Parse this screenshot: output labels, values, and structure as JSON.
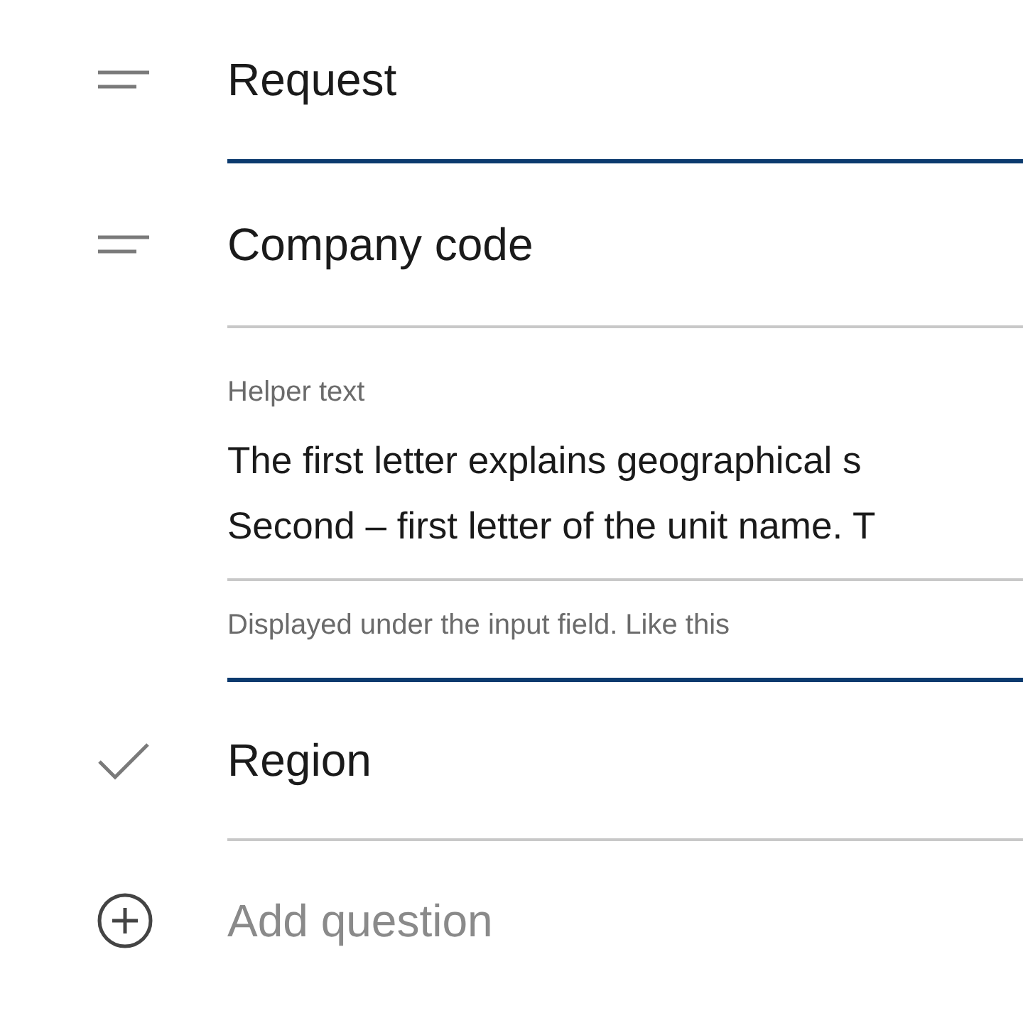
{
  "items": [
    {
      "kind": "question",
      "title": "Request",
      "expanded": false
    },
    {
      "kind": "question",
      "title": "Company code",
      "expanded": true,
      "field": {
        "label": "Helper text",
        "value_lines": [
          "The first letter explains geographical s",
          "Second – first letter of the unit name. T"
        ],
        "hint": "Displayed under the input field. Like this"
      }
    },
    {
      "kind": "answered",
      "title": "Region",
      "expanded": false
    },
    {
      "kind": "action",
      "title": "Add question"
    }
  ]
}
